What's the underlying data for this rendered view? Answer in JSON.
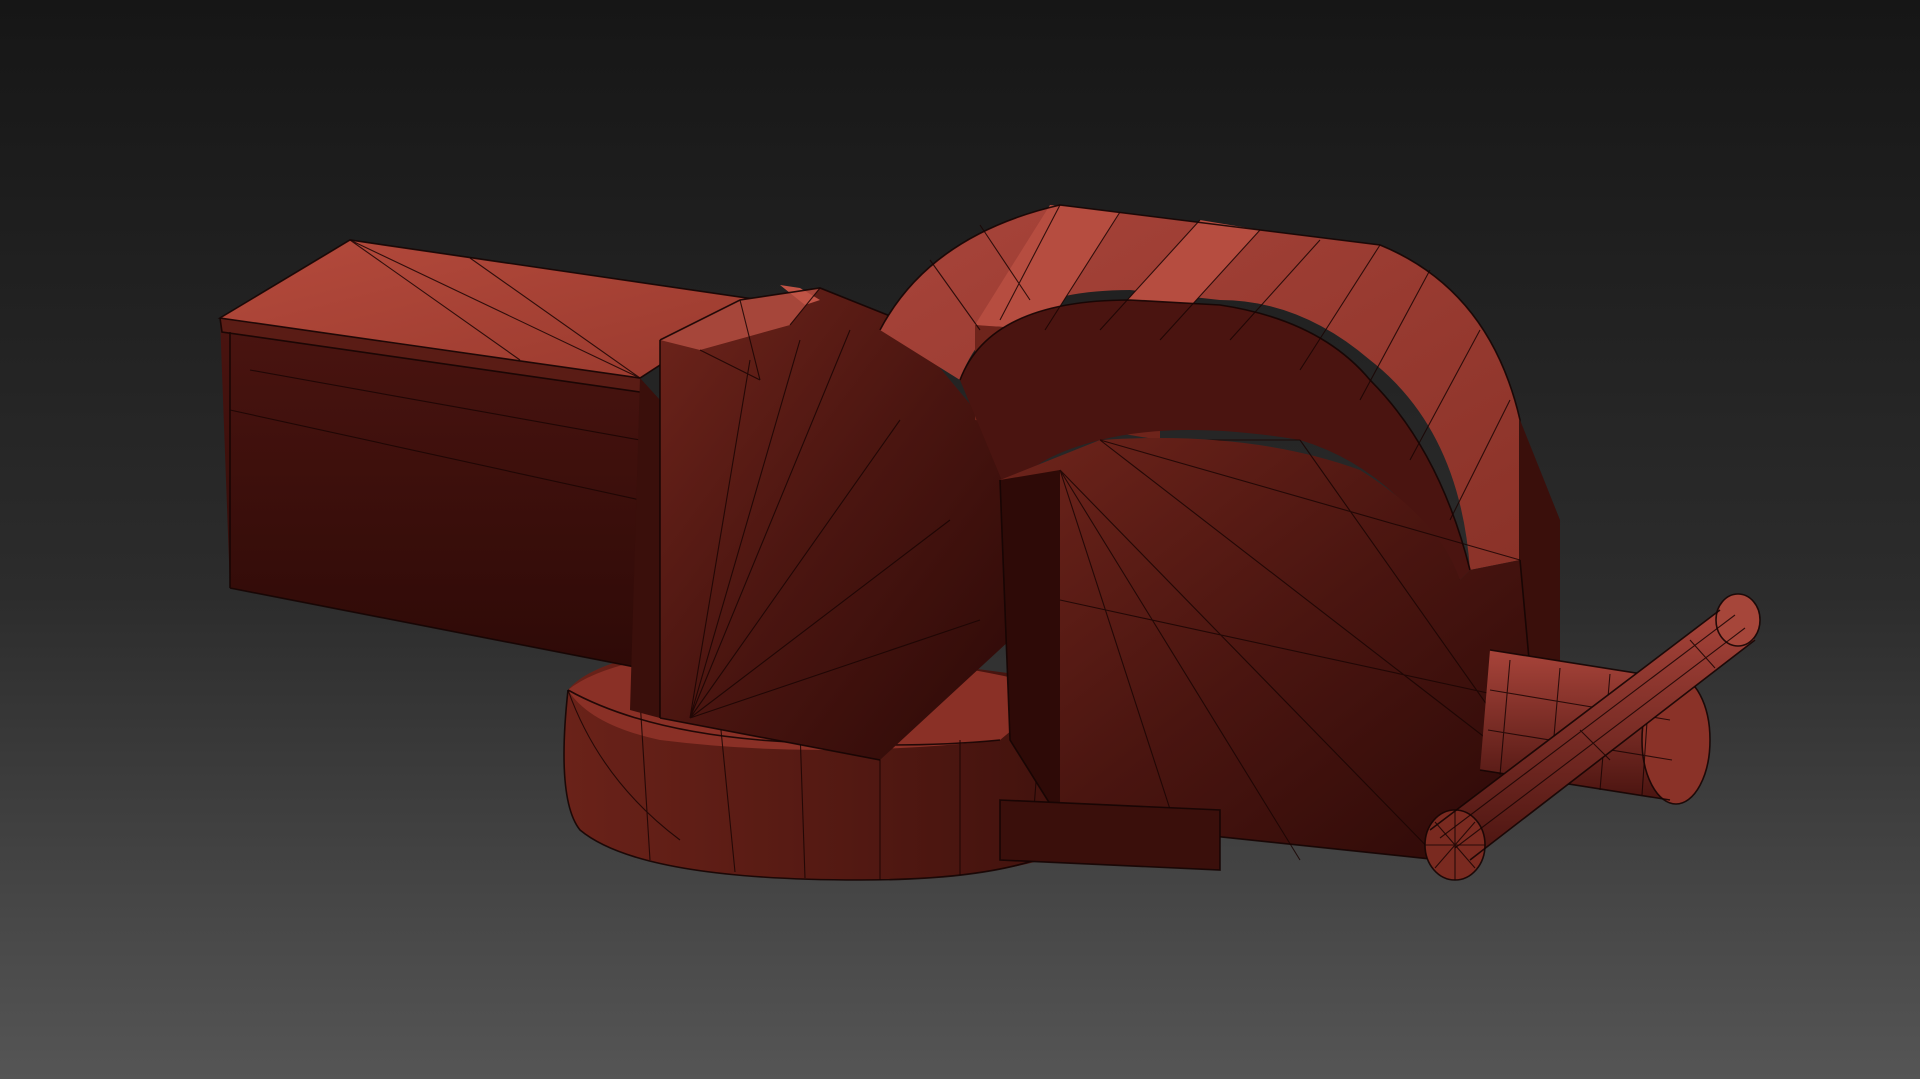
{
  "scene": {
    "subject": "bench-vise",
    "render_style": "wireframe-on-shaded",
    "colors": {
      "background_top": "#181818",
      "background_bottom": "#505050",
      "model_light": "#b84a3c",
      "model_mid": "#7a2a20",
      "model_dark": "#3a0f0b",
      "model_shadow": "#2a0806",
      "wire": "#1a0503"
    }
  }
}
